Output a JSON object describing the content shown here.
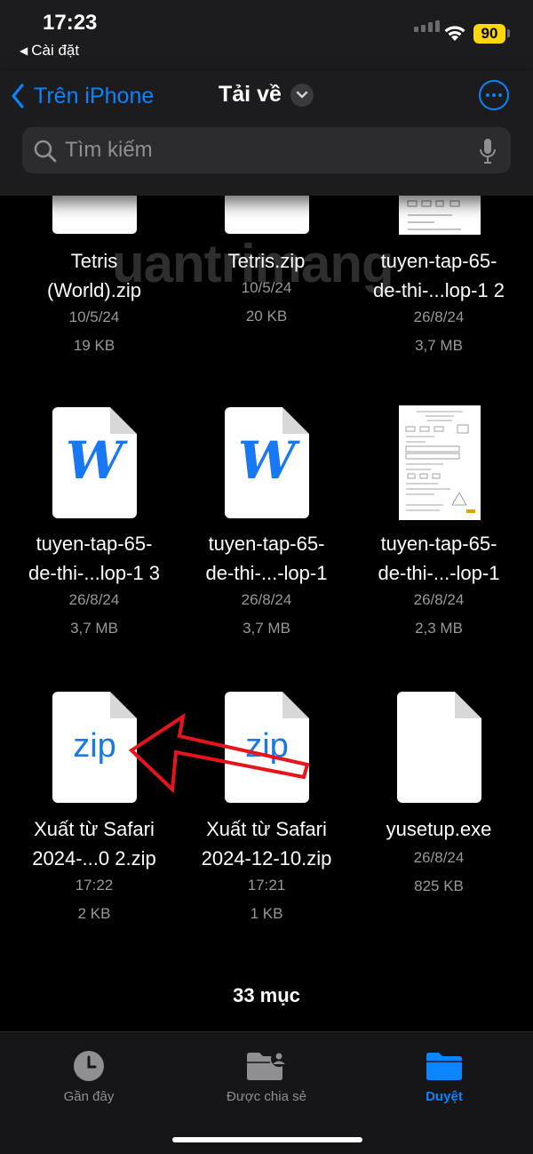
{
  "status_bar": {
    "time": "17:23",
    "back_app": "Cài đặt",
    "battery": "90"
  },
  "nav": {
    "back_label": "Trên iPhone",
    "title": "Tải về"
  },
  "search": {
    "placeholder": "Tìm kiếm"
  },
  "watermark": "uantrimang",
  "files": [
    {
      "name_line1": "Tetris",
      "name_line2": "(World).zip",
      "date": "10/5/24",
      "size": "19 KB",
      "icon": "blank-document-icon"
    },
    {
      "name_line1": "Tetris.zip",
      "name_line2": "",
      "date": "10/5/24",
      "size": "20 KB",
      "icon": "blank-document-icon"
    },
    {
      "name_line1": "tuyen-tap-65-",
      "name_line2": "de-thi-...lop-1 2",
      "date": "26/8/24",
      "size": "3,7 MB",
      "icon": "worksheet-thumbnail"
    },
    {
      "name_line1": "tuyen-tap-65-",
      "name_line2": "de-thi-...lop-1 3",
      "date": "26/8/24",
      "size": "3,7 MB",
      "icon": "word-document-icon"
    },
    {
      "name_line1": "tuyen-tap-65-",
      "name_line2": "de-thi-...-lop-1",
      "date": "26/8/24",
      "size": "3,7 MB",
      "icon": "word-document-icon"
    },
    {
      "name_line1": "tuyen-tap-65-",
      "name_line2": "de-thi-...-lop-1",
      "date": "26/8/24",
      "size": "2,3 MB",
      "icon": "worksheet-thumbnail"
    },
    {
      "name_line1": "Xuất từ Safari",
      "name_line2": "2024-...0 2.zip",
      "date": "17:22",
      "size": "2 KB",
      "icon": "zip-file-icon"
    },
    {
      "name_line1": "Xuất từ Safari",
      "name_line2": "2024-12-10.zip",
      "date": "17:21",
      "size": "1 KB",
      "icon": "zip-file-icon"
    },
    {
      "name_line1": "yusetup.exe",
      "name_line2": "",
      "date": "26/8/24",
      "size": "825 KB",
      "icon": "blank-document-icon"
    }
  ],
  "icons": {
    "word_glyph": "W",
    "zip_glyph": "zip"
  },
  "item_count": "33 mục",
  "tabs": [
    {
      "label": "Gần đây",
      "icon": "clock-icon",
      "active": false
    },
    {
      "label": "Được chia sẻ",
      "icon": "shared-folder-icon",
      "active": false
    },
    {
      "label": "Duyệt",
      "icon": "folder-icon",
      "active": true
    }
  ],
  "colors": {
    "accent": "#0a84ff",
    "battery": "#ffd60a",
    "annotation_arrow": "#e8141c",
    "background": "#000000"
  }
}
